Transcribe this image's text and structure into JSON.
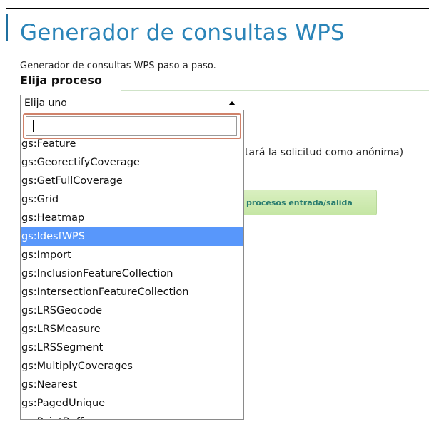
{
  "header": {
    "title": "Generador de consultas WPS",
    "subtitle": "Generador de consultas WPS paso a paso."
  },
  "section": {
    "heading": "Elija proceso"
  },
  "select": {
    "value": "Elija uno"
  },
  "search": {
    "value": ""
  },
  "options": [
    "gs:Feature",
    "gs:GeorectifyCoverage",
    "gs:GetFullCoverage",
    "gs:Grid",
    "gs:Heatmap",
    "gs:IdesfWPS",
    "gs:Import",
    "gs:InclusionFeatureCollection",
    "gs:IntersectionFeatureCollection",
    "gs:LRSGeocode",
    "gs:LRSMeasure",
    "gs:LRSSegment",
    "gs:MultiplyCoverages",
    "gs:Nearest",
    "gs:PagedUnique",
    "gs:PointBuffers"
  ],
  "highlighted_option": "gs:IdesfWPS",
  "background": {
    "partial_text": "tará la solicitud como anónima)",
    "button_label": "procesos entrada/salida"
  },
  "colors": {
    "title": "#2a84b8",
    "highlight": "#5897fb",
    "search_border": "#d0826a",
    "button_bg": "#c5e6a4",
    "button_text": "#2a7d6f"
  }
}
